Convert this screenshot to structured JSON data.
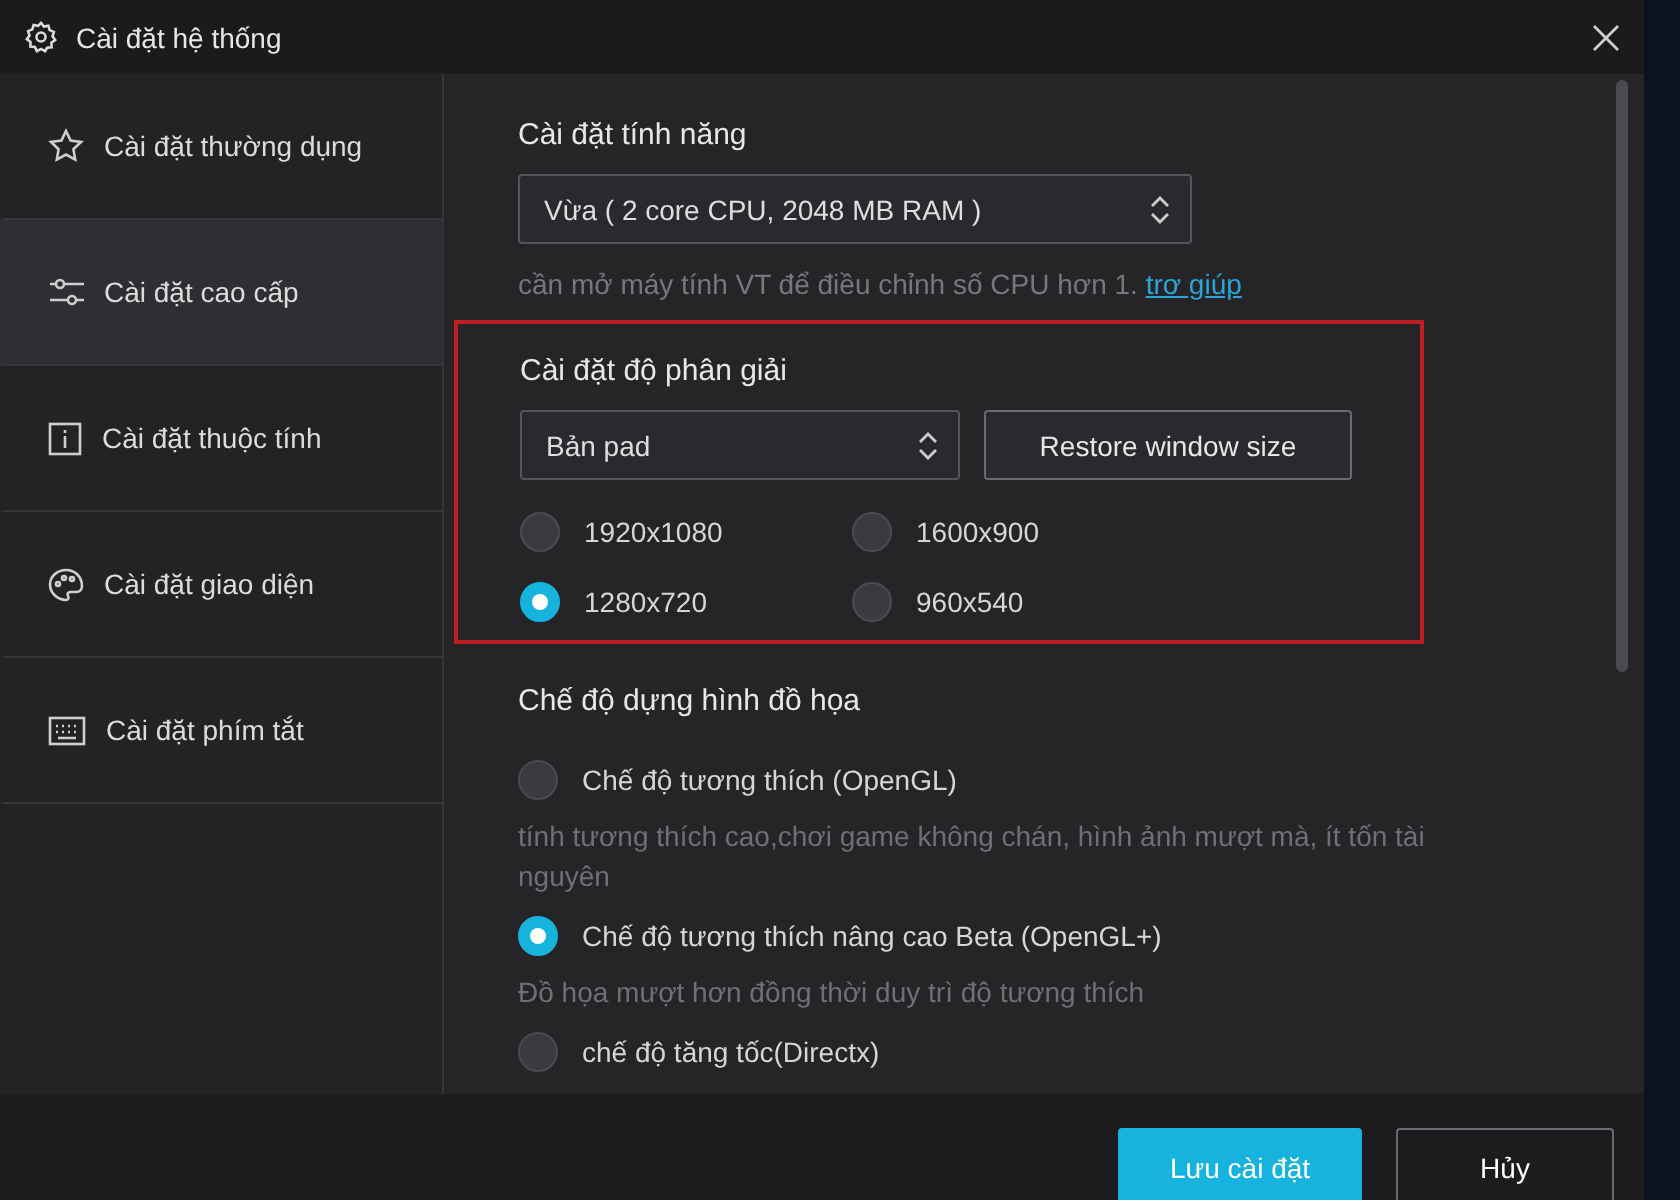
{
  "window": {
    "title": "Cài đặt hệ thống"
  },
  "sidebar": {
    "items": [
      {
        "label": "Cài đặt thường dụng",
        "selected": false
      },
      {
        "label": "Cài đặt cao cấp",
        "selected": true
      },
      {
        "label": "Cài đặt thuộc tính",
        "selected": false
      },
      {
        "label": "Cài đặt giao diện",
        "selected": false
      },
      {
        "label": "Cài đặt phím tắt",
        "selected": false
      }
    ]
  },
  "performance": {
    "title": "Cài đặt tính năng",
    "select_value": "Vừa ( 2 core CPU, 2048 MB RAM )",
    "hint": "cần mở máy tính VT để điều chỉnh số CPU hơn 1.",
    "help_link": "trơ giúp"
  },
  "resolution": {
    "title": "Cài đặt độ phân giải",
    "highlighted": true,
    "select_value": "Bản pad",
    "restore_button": "Restore window size",
    "options": [
      {
        "label": "1920x1080",
        "selected": false
      },
      {
        "label": "1600x900",
        "selected": false
      },
      {
        "label": "1280x720",
        "selected": true
      },
      {
        "label": "960x540",
        "selected": false
      }
    ]
  },
  "render": {
    "title": "Chế độ dựng hình đồ họa",
    "options": [
      {
        "label": "Chế độ tương thích (OpenGL)",
        "selected": false,
        "description": "tính tương thích cao,chơi game không chán, hình ảnh mượt mà, ít tốn tài nguyên"
      },
      {
        "label": "Chế độ tương thích nâng cao Beta (OpenGL+)",
        "selected": true,
        "description": "Đồ họa mượt hơn đồng thời duy trì độ tương thích"
      },
      {
        "label": "chế độ tăng tốc(Directx)",
        "selected": false
      }
    ]
  },
  "buttons": [
    {
      "label": "Lưu cài đặt",
      "kind": "primary"
    },
    {
      "label": "Hủy",
      "kind": "secondary"
    }
  ]
}
